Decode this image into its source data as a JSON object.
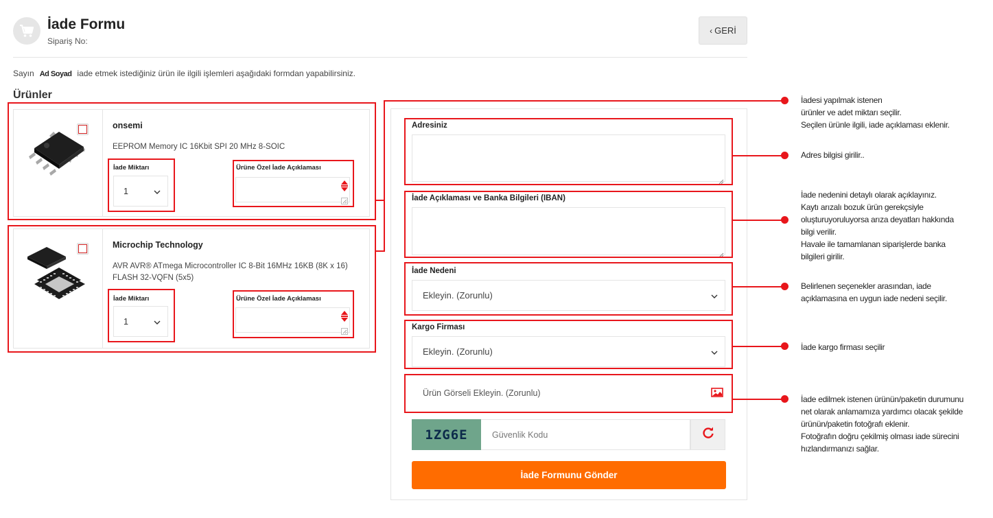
{
  "header": {
    "title": "İade Formu",
    "order_label": "Sipariş No:",
    "back_label": "GERİ"
  },
  "intro": {
    "prefix": "Sayın",
    "name": "Ad Soyad",
    "suffix": "iade etmek istediğiniz ürün ile ilgili işlemleri aşağıdaki formdan yapabilirsiniz."
  },
  "products_title": "Ürünler",
  "products": [
    {
      "brand": "onsemi",
      "description": "EEPROM Memory IC 16Kbit SPI 20 MHz 8-SOIC",
      "qty_label": "İade Miktarı",
      "qty_value": "1",
      "note_label": "Ürüne Özel İade Açıklaması"
    },
    {
      "brand": "Microchip Technology",
      "description": "AVR AVR® ATmega Microcontroller IC 8-Bit 16MHz 16KB (8K x 16) FLASH 32-VQFN (5x5)",
      "qty_label": "İade Miktarı",
      "qty_value": "1",
      "note_label": "Ürüne Özel İade Açıklaması"
    }
  ],
  "form": {
    "address_label": "Adresiniz",
    "iban_label": "İade Açıklaması ve Banka Bilgileri (IBAN)",
    "reason_label": "İade Nedeni",
    "reason_value": "Ekleyin. (Zorunlu)",
    "cargo_label": "Kargo Firması",
    "cargo_value": "Ekleyin. (Zorunlu)",
    "image_upload": "Ürün Görseli Ekleyin. (Zorunlu)",
    "captcha_code": "1ZG6E",
    "captcha_placeholder": "Güvenlik Kodu",
    "submit_label": "İade Formunu Gönder"
  },
  "annotations": {
    "products": [
      "İadesi  yapılmak istenen",
      "ürünler ve adet miktarı seçilir.",
      "Seçilen ürünle ilgili, iade açıklaması eklenir."
    ],
    "address": [
      "Adres bilgisi girilir.."
    ],
    "iban": [
      "İade nedenini detaylı olarak açıklayınız.",
      "Kaytı arızalı bozuk ürün gerekçsiyle",
      "oluşturuyoruluyorsa arıza deyatları hakkında",
      "bilgi verilir.",
      "Havale ile tamamlanan siparişlerde banka",
      "bilgileri girilir."
    ],
    "reason": [
      "Belirlenen seçenekler arasından, iade",
      "açıklamasına en uygun iade nedeni seçilir."
    ],
    "cargo": [
      "İade kargo firması seçilir"
    ],
    "image": [
      "İade edilmek istenen ürünün/paketin durumunu",
      "net olarak anlamamıza yardımcı olacak şekilde",
      "ürünün/paketin fotoğrafı eklenir.",
      "Fotoğrafın doğru çekilmiş olması iade sürecini",
      "hızlandırmanızı sağlar."
    ]
  },
  "colors": {
    "accent": "#ff6c00",
    "highlight": "#e8161b",
    "captcha_bg": "#6fa58b"
  }
}
